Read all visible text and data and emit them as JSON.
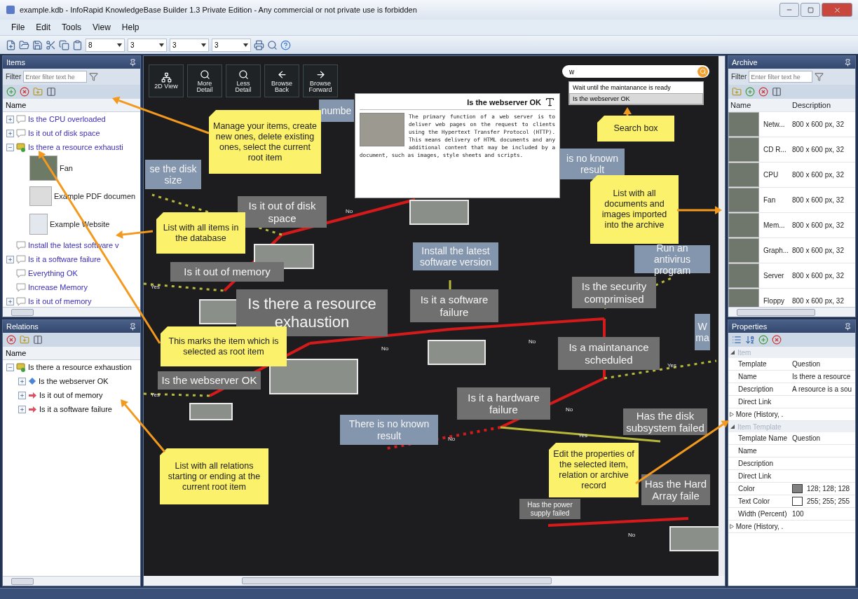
{
  "window": {
    "title": "example.kdb - InfoRapid KnowledgeBase Builder 1.3 Private Edition - Any commercial or not private use is forbidden"
  },
  "menu": [
    "File",
    "Edit",
    "Tools",
    "View",
    "Help"
  ],
  "toolbar": {
    "spinners": [
      "8",
      "3",
      "3",
      "3"
    ]
  },
  "items_panel": {
    "title": "Items",
    "filter_label": "Filter",
    "filter_placeholder": "Enter filter text he",
    "column": "Name",
    "tree": [
      {
        "label": "Is the CPU overloaded",
        "kind": "question",
        "expanded": false,
        "root": false
      },
      {
        "label": "Is it out of disk space",
        "kind": "question",
        "expanded": false,
        "root": false
      },
      {
        "label": "Is there a resource exhausti",
        "kind": "question",
        "expanded": true,
        "root": true,
        "children": [
          {
            "label": "Fan",
            "kind": "photo"
          },
          {
            "label": "Example PDF documen",
            "kind": "document"
          },
          {
            "label": "Example Website",
            "kind": "website"
          }
        ]
      },
      {
        "label": "Install the latest software v",
        "kind": "answer",
        "root": false
      },
      {
        "label": "Is it a software failure",
        "kind": "question",
        "expanded": false,
        "root": false
      },
      {
        "label": "Everything OK",
        "kind": "answer",
        "root": false
      },
      {
        "label": "Increase Memory",
        "kind": "answer",
        "root": false
      },
      {
        "label": "Is it out of memory",
        "kind": "question",
        "expanded": false,
        "root": false
      }
    ]
  },
  "relations_panel": {
    "title": "Relations",
    "column": "Name",
    "tree": [
      {
        "label": "Is there a resource exhaustion",
        "kind": "root",
        "expanded": true,
        "children": [
          {
            "label": "Is the webserver OK",
            "kind": "diamond",
            "expanded": false
          },
          {
            "label": "Is it out of memory",
            "kind": "arrow",
            "expanded": false
          },
          {
            "label": "Is it a software failure",
            "kind": "arrow",
            "expanded": false
          }
        ]
      }
    ]
  },
  "canvas": {
    "buttons": [
      {
        "label": "2D View",
        "kind": "graph"
      },
      {
        "label": "More Detail",
        "kind": "zoom_in"
      },
      {
        "label": "Less Detail",
        "kind": "zoom_out"
      },
      {
        "label": "Browse Back",
        "kind": "back"
      },
      {
        "label": "Browse Forward",
        "kind": "forward"
      }
    ],
    "search": {
      "value": "w",
      "suggestions": [
        {
          "label": "Wait until the maintanance is ready",
          "selected": false
        },
        {
          "label": "Is the webserver OK",
          "selected": true
        }
      ]
    },
    "popup": {
      "title": "Is the webserver OK",
      "text": "The primary function of a web server is to deliver web pages on the request to clients using the Hypertext Transfer Protocol (HTTP). This means delivery of HTML documents and any additional content that may be included by a document, such as images, style sheets and scripts."
    },
    "nodes": [
      {
        "label": "numbe",
        "kind": "answer"
      },
      {
        "label": "se the disk size",
        "kind": "answer"
      },
      {
        "label": "Is it out of disk space",
        "kind": "question"
      },
      {
        "label": "Is it out of memory",
        "kind": "question"
      },
      {
        "label": "Is there a resource exhaustion",
        "kind": "root"
      },
      {
        "label": "Install the latest software version",
        "kind": "answer"
      },
      {
        "label": "Is it a software failure",
        "kind": "question"
      },
      {
        "label": "is no known result",
        "kind": "answer"
      },
      {
        "label": "Run an antivirus program",
        "kind": "answer"
      },
      {
        "label": "Is the security comprimised",
        "kind": "question"
      },
      {
        "label": "W ma",
        "kind": "answer"
      },
      {
        "label": "Is a maintanance scheduled",
        "kind": "question"
      },
      {
        "label": "Is the webserver OK",
        "kind": "question"
      },
      {
        "label": "Is it a hardware failure",
        "kind": "question"
      },
      {
        "label": "There is no known result",
        "kind": "answer"
      },
      {
        "label": "Has the disk subsystem failed",
        "kind": "question"
      },
      {
        "label": "Has the Hard Array faile",
        "kind": "question"
      },
      {
        "label": "Has the power supply failed",
        "kind": "small"
      }
    ],
    "edge_labels": [
      "No",
      "Yes",
      "No",
      "No",
      "Yes",
      "No",
      "No",
      "Yes",
      "Yes",
      "No"
    ],
    "callouts": [
      "Manage your items, create new ones, delete existing ones, select the current root item",
      "Search box",
      "List with all items in the database",
      "List with all documents and images imported into the archive",
      "This marks the item which is selected as root item",
      "List with all relations starting or ending at the current root item",
      "Edit the properties of the selected item, relation or archive record"
    ]
  },
  "archive_panel": {
    "title": "Archive",
    "filter_label": "Filter",
    "filter_placeholder": "Enter filter text he",
    "columns": [
      "Name",
      "Description"
    ],
    "rows": [
      {
        "name": "Netw...",
        "description": "800 x 600 px, 32"
      },
      {
        "name": "CD R...",
        "description": "800 x 600 px, 32"
      },
      {
        "name": "CPU",
        "description": "800 x 600 px, 32"
      },
      {
        "name": "Fan",
        "description": "800 x 600 px, 32"
      },
      {
        "name": "Mem...",
        "description": "800 x 600 px, 32"
      },
      {
        "name": "Graph...",
        "description": "800 x 600 px, 32"
      },
      {
        "name": "Server",
        "description": "800 x 600 px, 32"
      },
      {
        "name": "Floppy",
        "description": "800 x 600 px, 32"
      }
    ]
  },
  "properties_panel": {
    "title": "Properties",
    "categories": [
      {
        "label": "Item",
        "expanded": true,
        "rows": [
          {
            "name": "Template",
            "value": "Question"
          },
          {
            "name": "Name",
            "value": "Is there a resource"
          },
          {
            "name": "Description",
            "value": "A resource is a sou"
          },
          {
            "name": "Direct Link"
          },
          {
            "name": "More (History, .",
            "kind": "group",
            "expanded": false
          }
        ]
      },
      {
        "label": "Item Template",
        "expanded": true,
        "rows": [
          {
            "name": "Template Name",
            "value": "Question"
          },
          {
            "name": "Name"
          },
          {
            "name": "Description"
          },
          {
            "name": "Direct Link"
          },
          {
            "name": "Color",
            "value": "128; 128; 128",
            "color": "#808080"
          },
          {
            "name": "Text Color",
            "value": "255; 255; 255",
            "color": "#ffffff"
          },
          {
            "name": "Width (Percent)",
            "value": "100"
          },
          {
            "name": "More (History, .",
            "kind": "group",
            "expanded": false
          }
        ]
      }
    ]
  }
}
